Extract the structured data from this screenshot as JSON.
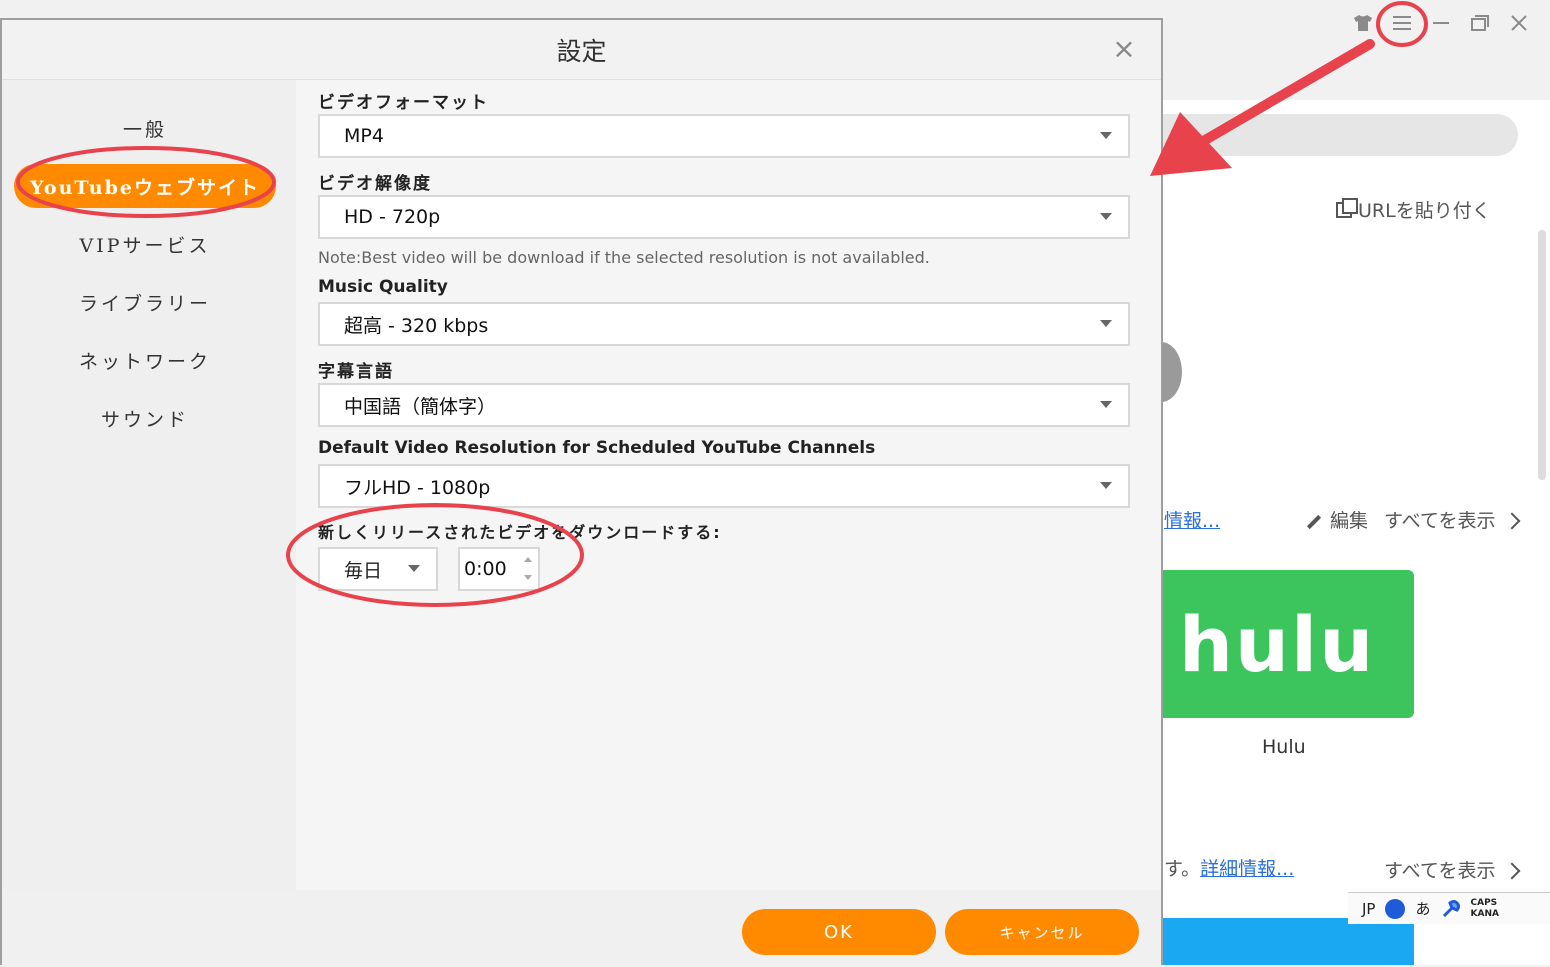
{
  "background": {
    "paste_url": "URLを貼り付く",
    "info_link": "情報...",
    "edit_label": "編集",
    "show_all_1": "すべてを表示",
    "hulu_logo": "hulu",
    "hulu_caption": "Hulu",
    "desc_suffix": "す。",
    "detail_link": "詳細情報...",
    "show_all_2": "すべてを表示",
    "ime_lang": "JP",
    "ime_kana": "あ",
    "ime_caps": "CAPS",
    "ime_kana_label": "KANA"
  },
  "dialog": {
    "title": "設定",
    "close": "×",
    "sidebar": [
      {
        "label": "一般"
      },
      {
        "label": "YouTubeウェブサイト"
      },
      {
        "label": "VIPサービス"
      },
      {
        "label": "ライブラリー"
      },
      {
        "label": "ネットワーク"
      },
      {
        "label": "サウンド"
      }
    ],
    "fields": {
      "video_format_label": "ビデオフォーマット",
      "video_format_value": "MP4",
      "video_resolution_label": "ビデオ解像度",
      "video_resolution_value": "HD - 720p",
      "note": "Note:Best video will be download if the selected resolution is not availabled.",
      "music_quality_label": "Music Quality",
      "music_quality_value": "超高 - 320 kbps",
      "subtitle_label": "字幕言語",
      "subtitle_value": "中国語（簡体字）",
      "scheduled_label": "Default Video Resolution for Scheduled YouTube Channels",
      "scheduled_value": "フルHD - 1080p",
      "download_new_label": "新しくリリースされたビデオをダウンロードする:",
      "frequency_value": "毎日",
      "time_value": "0:00"
    },
    "buttons": {
      "ok": "OK",
      "cancel": "キャンセル"
    }
  },
  "colors": {
    "accent": "#ff8a00",
    "annotation": "#e8434c",
    "hulu": "#3cc55c"
  }
}
